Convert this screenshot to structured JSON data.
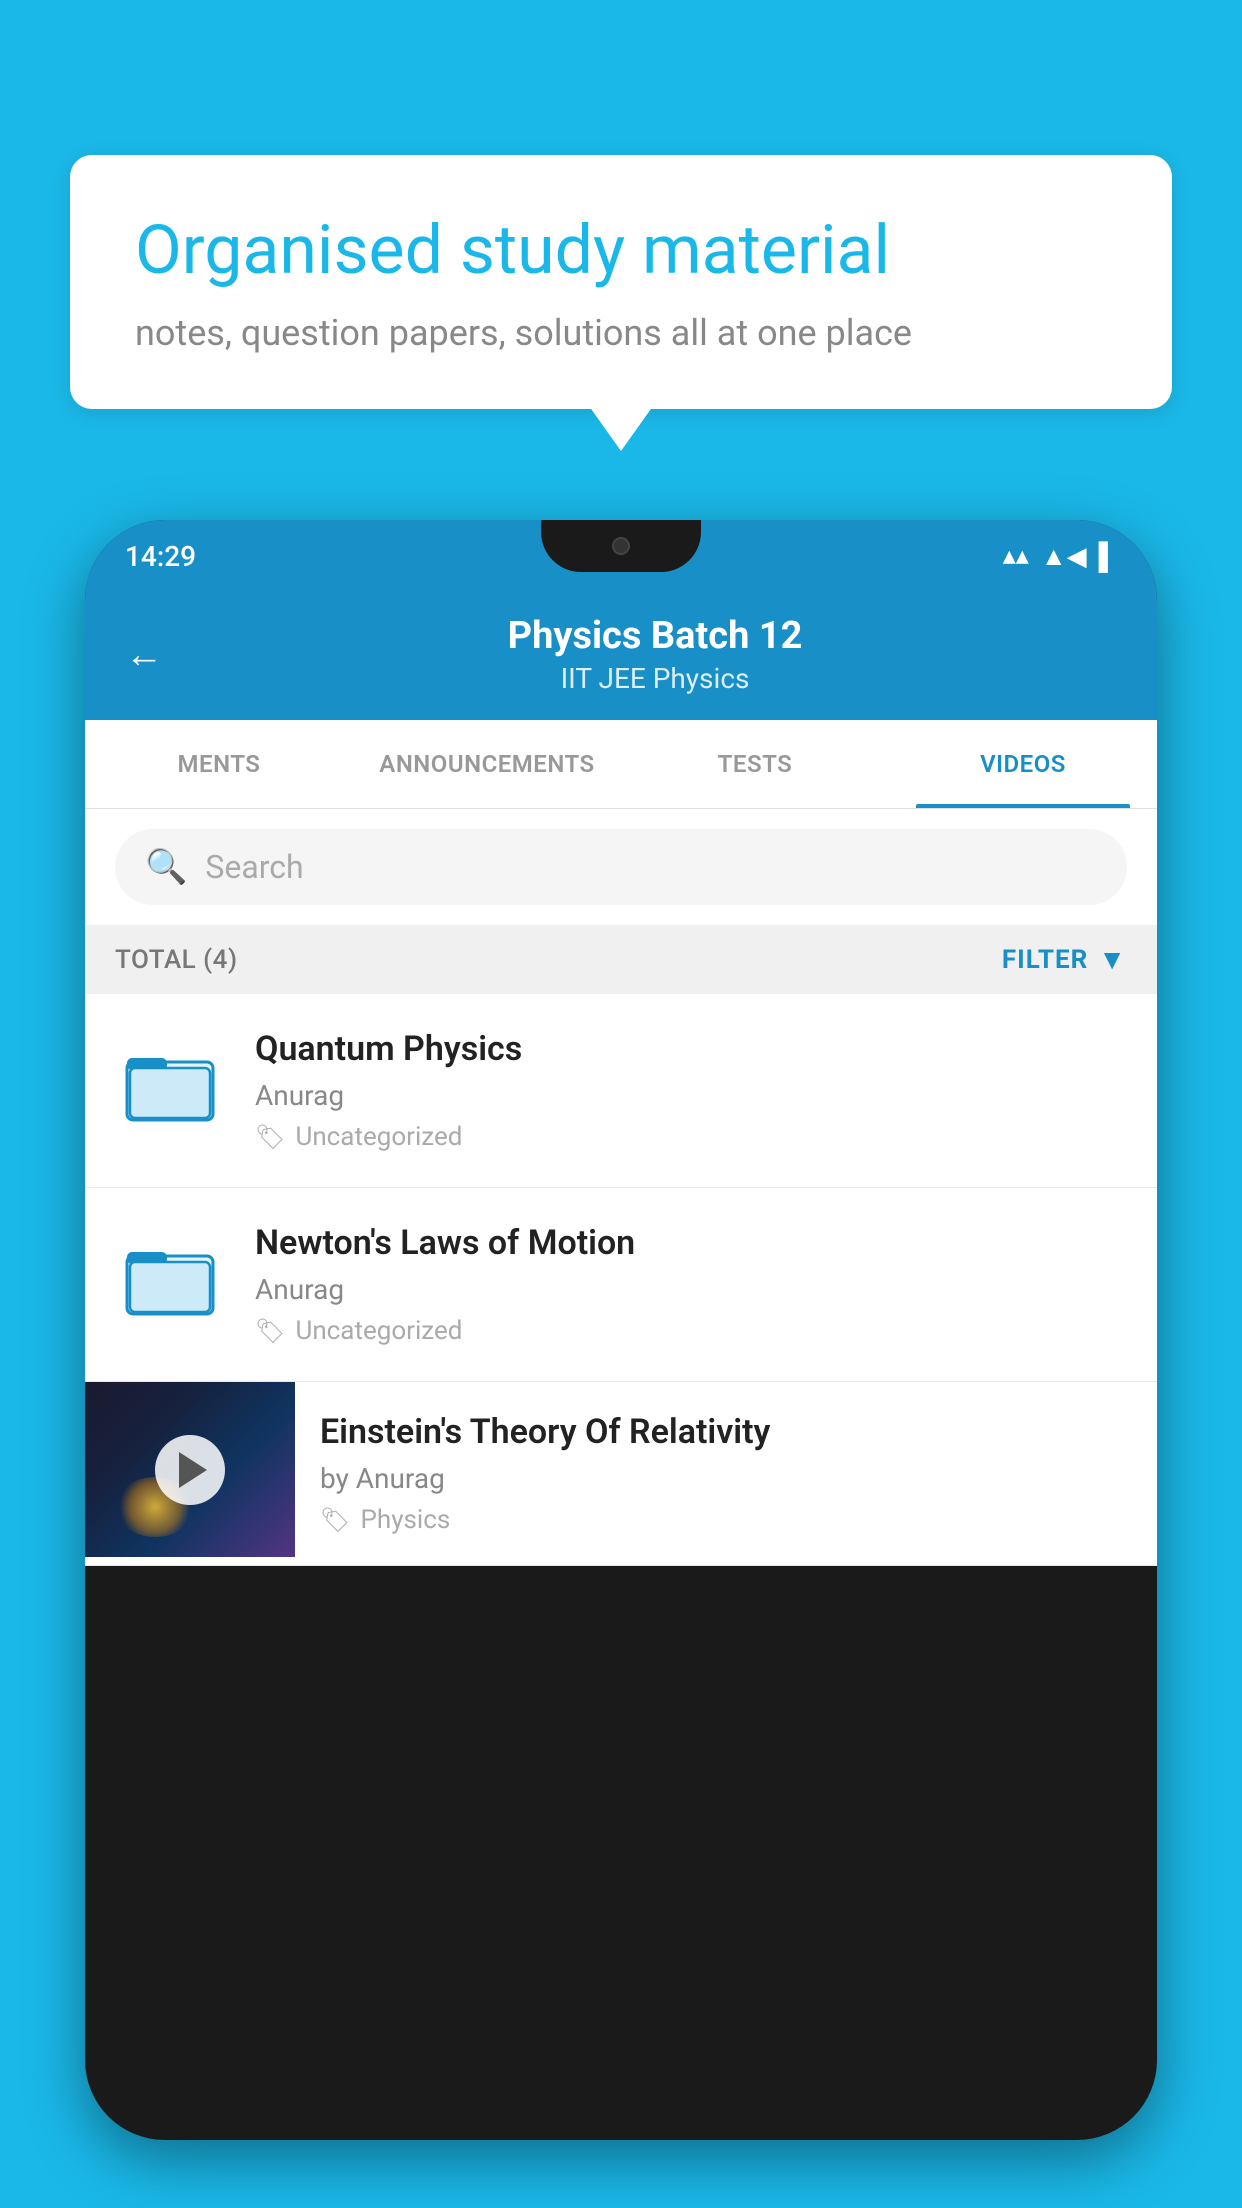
{
  "background_color": "#1ab8e8",
  "speech_bubble": {
    "title": "Organised study material",
    "subtitle": "notes, question papers, solutions all at one place"
  },
  "phone": {
    "status_bar": {
      "time": "14:29",
      "icons": [
        "wifi",
        "signal",
        "battery"
      ]
    },
    "app_header": {
      "back_label": "←",
      "title": "Physics Batch 12",
      "subtitle": "IIT JEE   Physics"
    },
    "tabs": [
      {
        "label": "MENTS",
        "active": false
      },
      {
        "label": "ANNOUNCEMENTS",
        "active": false
      },
      {
        "label": "TESTS",
        "active": false
      },
      {
        "label": "VIDEOS",
        "active": true
      }
    ],
    "search": {
      "placeholder": "Search"
    },
    "filter_bar": {
      "total_label": "TOTAL (4)",
      "filter_label": "FILTER"
    },
    "videos": [
      {
        "title": "Quantum Physics",
        "author": "Anurag",
        "tag": "Uncategorized",
        "has_thumbnail": false
      },
      {
        "title": "Newton's Laws of Motion",
        "author": "Anurag",
        "tag": "Uncategorized",
        "has_thumbnail": false
      },
      {
        "title": "Einstein's Theory Of Relativity",
        "author": "by Anurag",
        "tag": "Physics",
        "has_thumbnail": true
      }
    ]
  }
}
